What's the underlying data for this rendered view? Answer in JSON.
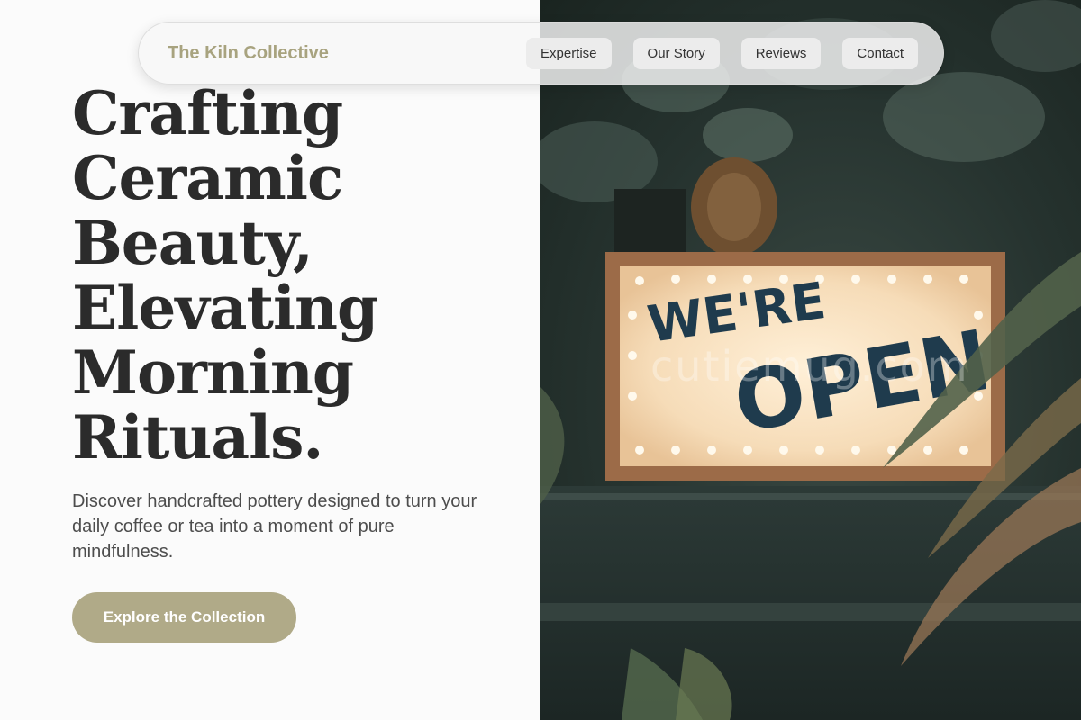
{
  "nav": {
    "brand": "The Kiln Collective",
    "links": [
      {
        "label": "Expertise"
      },
      {
        "label": "Our Story"
      },
      {
        "label": "Reviews"
      },
      {
        "label": "Contact"
      }
    ]
  },
  "hero": {
    "title_lines": [
      "Crafting",
      "Ceramic",
      "Beauty,",
      "Elevating",
      "Morning",
      "Rituals."
    ],
    "subtitle": "Discover handcrafted pottery designed to turn your daily coffee or tea into a moment of pure mindfulness.",
    "cta_label": "Explore the Collection"
  },
  "image": {
    "sign_line1": "WE'RE",
    "sign_line2": "OPEN",
    "watermark": "cutiemug.com"
  },
  "colors": {
    "accent": "#b0aa88",
    "brand_text": "#a8a37f",
    "heading": "#2b2b2b",
    "background": "#fbfbfb"
  }
}
